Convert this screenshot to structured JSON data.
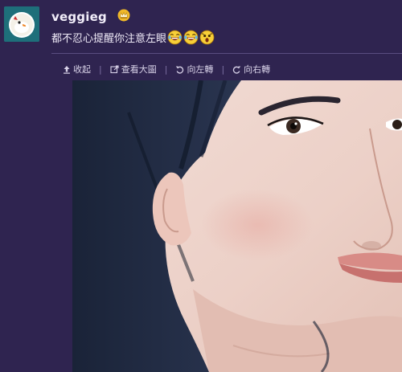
{
  "post": {
    "username": "veggieg",
    "text": "都不忍心提醒你注意左眼",
    "emojis": [
      "laughing-crying-emoji",
      "laughing-crying-emoji",
      "shocked-emoji"
    ]
  },
  "toolbar": {
    "collapse": "收起",
    "view_large": "查看大圖",
    "rotate_left": "向左轉",
    "rotate_right": "向右轉"
  },
  "icons": {
    "avatar": "duck-avatar-icon",
    "badge": "crown-badge-icon",
    "collapse": "upload-arrow-icon",
    "view_large": "external-link-icon",
    "rotate_left": "rotate-left-icon",
    "rotate_right": "rotate-right-icon"
  },
  "colors": {
    "background": "#2f2450",
    "text": "#f2eefa",
    "badge": "#f0b829",
    "avatar_bg": "#1e6f7a"
  }
}
